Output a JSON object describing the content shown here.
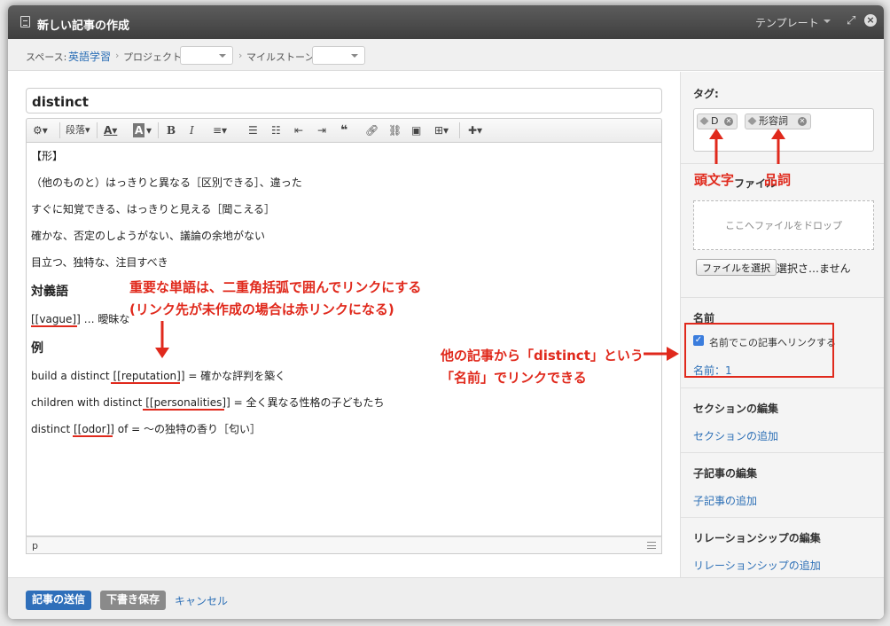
{
  "modal": {
    "title": "新しい記事の作成",
    "template_label": "テンプレート",
    "close_glyph": "×",
    "expand_glyph": "⤢"
  },
  "breadcrumb": {
    "space_label": "スペース:",
    "space_value": "英語学習",
    "project_label": "プロジェクト",
    "milestone_label": "マイルストーン",
    "sep": "›"
  },
  "editor": {
    "title_value": "distinct",
    "toolbar": {
      "paragraph_label": "段落",
      "bold": "B",
      "italic": "I",
      "text_color": "A",
      "bg_color": "A"
    },
    "lines": [
      "【形】",
      "（他のものと）はっきりと異なる［区別できる］、違った",
      "すぐに知覚できる、はっきりと見える［聞こえる］",
      "確かな、否定のしようがない、議論の余地がない",
      "目立つ、独特な、注目すべき"
    ],
    "heading_antonym": "対義語",
    "antonym_line": "[[vague]] … 曖昧な",
    "heading_example": "例",
    "examples": [
      "build a distinct [[reputation]] = 確かな評判を築く",
      "children with distinct [[personalities]] = 全く異なる性格の子どもたち",
      "distinct [[odor]] of = 〜の独特の香り［匂い］"
    ],
    "status_tag": "p"
  },
  "sidebar": {
    "tags_label": "タグ:",
    "tags": [
      {
        "label": "D"
      },
      {
        "label": "形容詞"
      }
    ],
    "file_section_label": "ファイル",
    "drop_text": "ここへファイルをドロップ",
    "file_button": "ファイルを選択",
    "file_status": "選択さ…ません",
    "name_label": "名前",
    "link_checkbox_label": "名前でこの記事へリンクする",
    "name_count": "名前：1",
    "sections_label": "セクションの編集",
    "sections_add": "セクションの追加",
    "child_label": "子記事の編集",
    "child_add": "子記事の追加",
    "rel_label": "リレーションシップの編集",
    "rel_add": "リレーションシップの追加"
  },
  "footer": {
    "submit": "記事の送信",
    "draft": "下書き保存",
    "cancel": "キャンセル"
  },
  "annotations": {
    "initial": "頭文字",
    "pos": "品詞",
    "wiki_line1": "重要な単語は、二重角括弧で囲んでリンクにする",
    "wiki_line2": "(リンク先が未作成の場合は赤リンクになる)",
    "name_line1": "他の記事から「distinct」という",
    "name_line2": "「名前」でリンクできる"
  },
  "colors": {
    "accent": "#2c6fb6",
    "annotation": "#e0291c",
    "submit_bg": "#2f6fba",
    "draft_bg": "#8a8a8a"
  }
}
